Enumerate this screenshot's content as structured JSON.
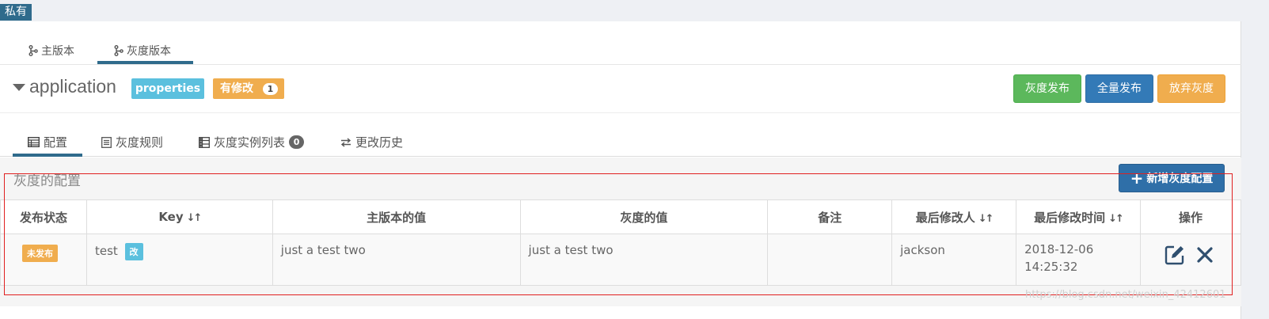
{
  "top": {
    "private_label": "私有"
  },
  "branch_tabs": [
    {
      "label": "主版本"
    },
    {
      "label": "灰度版本"
    }
  ],
  "namespace": {
    "name": "application",
    "format_tag": "properties",
    "modified_tag": "有修改",
    "modified_count": "1"
  },
  "actions": {
    "gray_release": "灰度发布",
    "full_release": "全量发布",
    "abandon_gray": "放弃灰度"
  },
  "sub_tabs": [
    {
      "label": "配置"
    },
    {
      "label": "灰度规则"
    },
    {
      "label": "灰度实例列表",
      "count": "0"
    },
    {
      "label": "更改历史"
    }
  ],
  "section": {
    "title": "灰度的配置",
    "add_button": "新增灰度配置"
  },
  "table": {
    "headers": {
      "status": "发布状态",
      "key": "Key",
      "master_value": "主版本的值",
      "gray_value": "灰度的值",
      "comment": "备注",
      "modifier": "最后修改人",
      "modified_time": "最后修改时间",
      "ops": "操作"
    },
    "rows": [
      {
        "status": "未发布",
        "key": "test",
        "key_tag": "改",
        "master_value": "just a test two",
        "gray_value": "just a test two",
        "comment": "",
        "modifier": "jackson",
        "modified_time": "2018-12-06 14:25:32"
      }
    ]
  },
  "watermark": "https://blog.csdn.net/weixin_42412601",
  "colors": {
    "primary": "#337ab7",
    "success": "#5cb85c",
    "warning": "#f0ad4e",
    "info": "#5bc0de",
    "brand_dark": "#2f6b8c",
    "highlight_frame": "#e02020"
  }
}
